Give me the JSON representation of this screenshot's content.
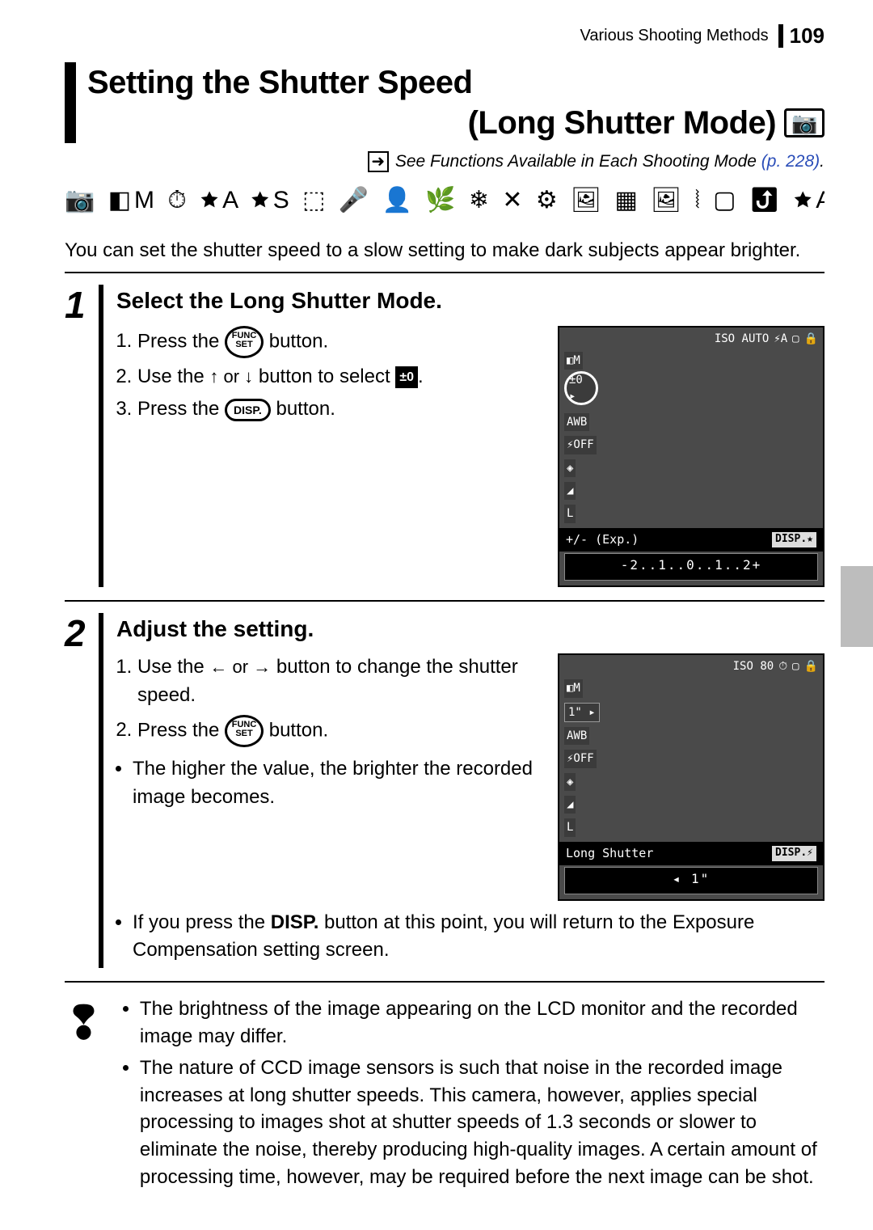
{
  "header": {
    "chapter": "Various Shooting Methods",
    "page_number": "109"
  },
  "title": {
    "line1": "Setting the Shutter Speed",
    "line2": "(Long Shutter Mode)"
  },
  "see_ref": {
    "text": "See Functions Available in Each Shooting Mode",
    "page_link": "(p. 228)",
    "period": "."
  },
  "icon_strip": "📷 ◧M ⏱ 🟊A 🟊S ⬚ 🎤 👤 🌿 ❄ ✕ ⚙ 🖼 ▦ 🖼 ⦚ ▢ ⤴ 🟊A 🟊S ⠿",
  "intro": "You can set the shutter speed to a slow setting to make dark subjects appear brighter.",
  "steps": [
    {
      "num": "1",
      "heading": "Select the Long Shutter Mode.",
      "sub": [
        {
          "prefix": "Press the ",
          "button": "FUNC/SET",
          "suffix": " button."
        },
        {
          "prefix": "Use the ",
          "arrows": "↑ or ↓",
          "suffix": " button to select ",
          "pm": "±0",
          "tail": "."
        },
        {
          "prefix": "Press the ",
          "disp": "DISP.",
          "suffix": " button."
        }
      ],
      "lcd": {
        "top": [
          "ISO AUTO",
          "⚡A",
          "▢",
          "🔒"
        ],
        "side_main": "±0 ▸",
        "side": [
          "AWB",
          "⚡OFF",
          "◈",
          "◢",
          "L"
        ],
        "bottom_left": "+/- (Exp.)",
        "disp_tag": "DISP.★",
        "scale": "-2..1..0..1..2+"
      }
    },
    {
      "num": "2",
      "heading": "Adjust the setting.",
      "sub": [
        {
          "prefix": "Use the ",
          "arrows": "← or →",
          "suffix": " button to change the shutter speed."
        },
        {
          "prefix": "Press the ",
          "button": "FUNC/SET",
          "suffix": " button."
        }
      ],
      "bullets": [
        "The higher the value, the brighter the recorded image becomes.",
        "If you press the DISP. button at this point, you will return to the Exposure Compensation setting screen."
      ],
      "bullet_bold": "DISP.",
      "lcd": {
        "top": [
          "ISO 80",
          "⏱",
          "▢",
          "🔒"
        ],
        "side_main": "1\" ▸",
        "side": [
          "AWB",
          "⚡OFF",
          "◈",
          "◢",
          "L"
        ],
        "bottom_left": "Long Shutter",
        "disp_tag": "DISP.⚡",
        "scale": "◂ 1\""
      }
    }
  ],
  "notes": [
    "The brightness of the image appearing on the LCD monitor and the recorded image may differ.",
    "The nature of CCD image sensors is such that noise in the recorded image increases at long shutter speeds. This camera, however, applies special processing to images shot at shutter speeds of 1.3 seconds or slower to eliminate the noise, thereby producing high-quality images. A certain amount of processing time, however, may be required before the next image can be shot."
  ],
  "lcd_mode_label": "◧M"
}
